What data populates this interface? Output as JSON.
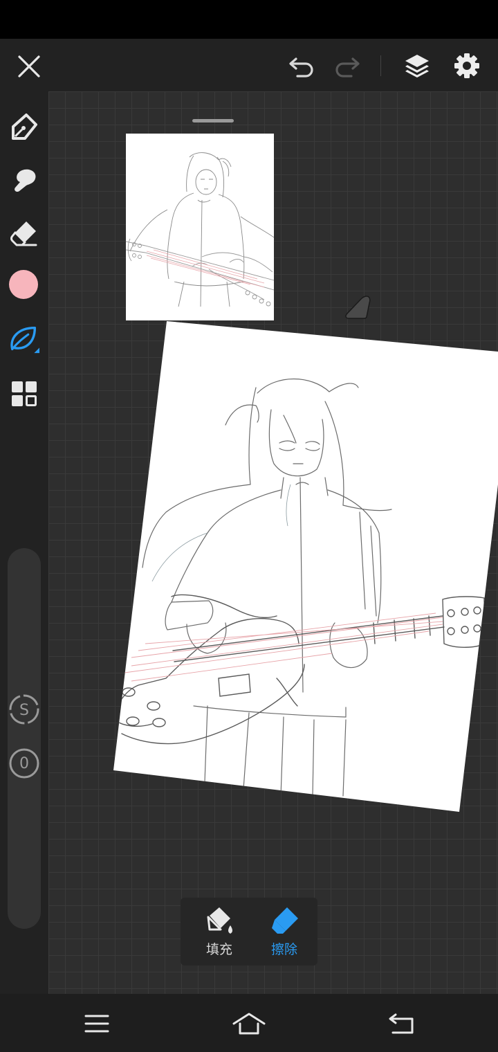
{
  "colors": {
    "accent": "#2a9bf2",
    "brush_color": "#f7b5bc",
    "icon": "#e8e8e8"
  },
  "toolbar": {
    "close": "close-icon",
    "undo": "undo-icon",
    "redo": "redo-icon",
    "layers": "layers-icon",
    "settings": "gear-icon"
  },
  "tools": [
    {
      "name": "pen",
      "icon": "pen-nib-icon",
      "active": false
    },
    {
      "name": "smudge",
      "icon": "smudge-icon",
      "active": false
    },
    {
      "name": "eraser",
      "icon": "eraser-icon",
      "active": false
    },
    {
      "name": "color",
      "icon": "color-swatch",
      "active": false
    },
    {
      "name": "brush",
      "icon": "leaf-brush-icon",
      "active": true
    },
    {
      "name": "materials",
      "icon": "grid-icon",
      "active": false
    }
  ],
  "side_controls": {
    "size_label": "S",
    "opacity_value": "0"
  },
  "popup": {
    "fill_label": "填充",
    "erase_label": "擦除",
    "selected": "erase"
  },
  "nav": {
    "menu": "menu-icon",
    "home": "home-icon",
    "back": "back-icon"
  }
}
